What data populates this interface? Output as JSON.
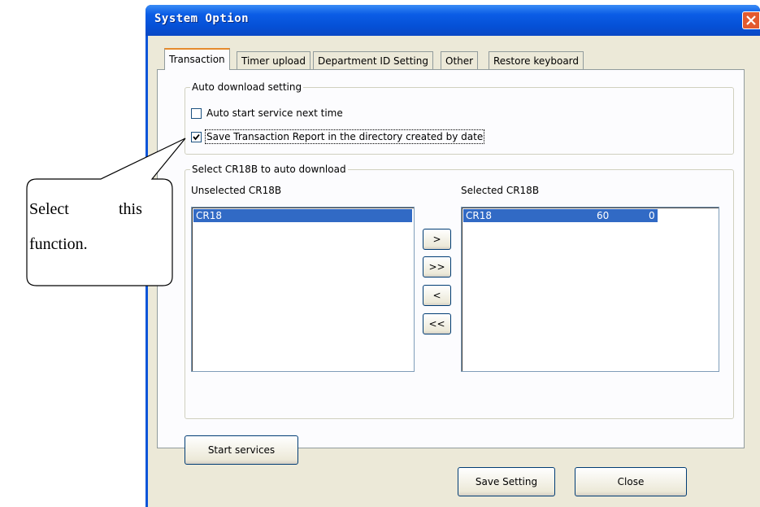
{
  "window": {
    "title": "System Option"
  },
  "tabs": [
    {
      "label": "Transaction",
      "active": true
    },
    {
      "label": "Timer upload",
      "active": false
    },
    {
      "label": "Department ID Setting",
      "active": false
    },
    {
      "label": "Other",
      "active": false
    },
    {
      "label": "Restore keyboard",
      "active": false
    }
  ],
  "auto_download": {
    "legend": "Auto download setting",
    "options": [
      {
        "label": "Auto start service next time",
        "checked": false
      },
      {
        "label": "Save Transaction Report in the directory created by date",
        "checked": true
      }
    ]
  },
  "select_group": {
    "legend": "Select CR18B to auto download",
    "unselected_label": "Unselected CR18B",
    "selected_label": "Selected CR18B",
    "unselected_items": [
      {
        "name": "CR18"
      }
    ],
    "selected_items": [
      {
        "name": "CR18",
        "col2": "60",
        "col3": "0"
      }
    ],
    "move_buttons": [
      ">",
      ">>",
      "<",
      "<<"
    ]
  },
  "buttons": {
    "start_services": "Start services",
    "save_setting": "Save Setting",
    "close": "Close"
  },
  "callout": {
    "line1_a": "Select",
    "line1_b": "this",
    "line2": "function."
  },
  "colors": {
    "titlebar": "#0550d6",
    "selection": "#316ac5",
    "tab_highlight": "#e68b2c",
    "dialog_bg": "#ece9d8"
  }
}
